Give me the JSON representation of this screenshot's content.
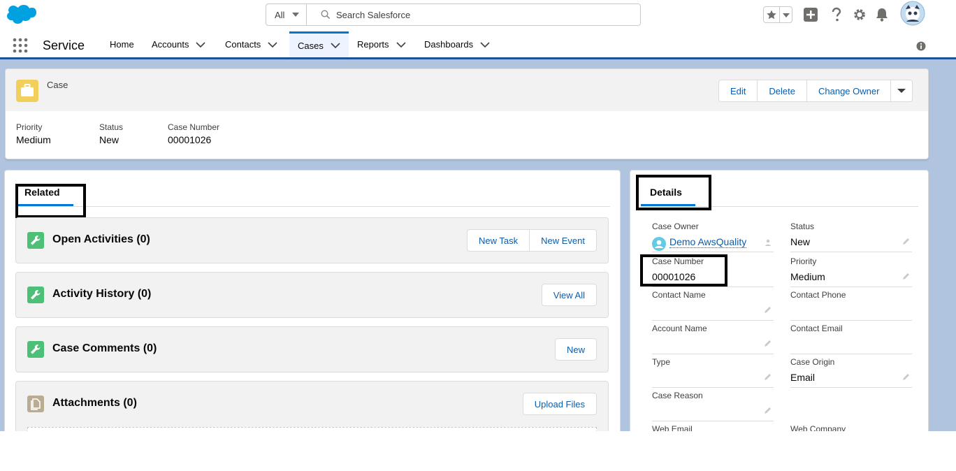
{
  "header": {
    "search_scope": "All",
    "search_placeholder": "Search Salesforce"
  },
  "nav": {
    "app_name": "Service",
    "items": [
      {
        "label": "Home",
        "has_menu": false,
        "active": false
      },
      {
        "label": "Accounts",
        "has_menu": true,
        "active": false
      },
      {
        "label": "Contacts",
        "has_menu": true,
        "active": false
      },
      {
        "label": "Cases",
        "has_menu": true,
        "active": true
      },
      {
        "label": "Reports",
        "has_menu": true,
        "active": false
      },
      {
        "label": "Dashboards",
        "has_menu": true,
        "active": false
      }
    ]
  },
  "record": {
    "entity_label": "Case",
    "actions": [
      "Edit",
      "Delete",
      "Change Owner"
    ],
    "highlights": [
      {
        "label": "Priority",
        "value": "Medium"
      },
      {
        "label": "Status",
        "value": "New"
      },
      {
        "label": "Case Number",
        "value": "00001026"
      }
    ]
  },
  "related": {
    "tab_label": "Related",
    "cards": [
      {
        "title": "Open Activities (0)",
        "buttons": [
          "New Task",
          "New Event"
        ],
        "icon": "wrench-icon"
      },
      {
        "title": "Activity History (0)",
        "buttons": [
          "View All"
        ],
        "icon": "wrench-icon"
      },
      {
        "title": "Case Comments (0)",
        "buttons": [
          "New"
        ],
        "icon": "wrench-icon"
      },
      {
        "title": "Attachments (0)",
        "buttons": [
          "Upload Files"
        ],
        "icon": "file-icon"
      }
    ]
  },
  "details": {
    "tab_label": "Details",
    "fields": {
      "case_owner": {
        "label": "Case Owner",
        "value": "Demo AwsQuality"
      },
      "status": {
        "label": "Status",
        "value": "New"
      },
      "case_number": {
        "label": "Case Number",
        "value": "00001026"
      },
      "priority": {
        "label": "Priority",
        "value": "Medium"
      },
      "contact_name": {
        "label": "Contact Name",
        "value": ""
      },
      "contact_phone": {
        "label": "Contact Phone",
        "value": ""
      },
      "account_name": {
        "label": "Account Name",
        "value": ""
      },
      "contact_email": {
        "label": "Contact Email",
        "value": ""
      },
      "type": {
        "label": "Type",
        "value": ""
      },
      "case_origin": {
        "label": "Case Origin",
        "value": "Email"
      },
      "case_reason": {
        "label": "Case Reason",
        "value": ""
      },
      "web_email": {
        "label": "Web Email",
        "value": ""
      },
      "web_company": {
        "label": "Web Company",
        "value": ""
      }
    }
  },
  "colors": {
    "brand": "#0176d3",
    "nav_active_bg": "#eef4ff",
    "case_icon": "#f2cf5b",
    "activity_icon": "#4bc076",
    "attachment_icon": "#baac93",
    "link": "#0b5cab",
    "annotation_box": "#000000"
  }
}
